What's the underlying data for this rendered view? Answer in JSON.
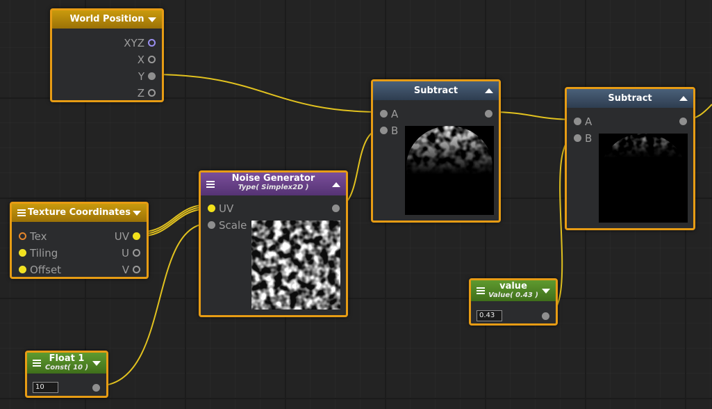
{
  "nodes": {
    "world_position": {
      "title": "World Position",
      "outputs": [
        "XYZ",
        "X",
        "Y",
        "Z"
      ]
    },
    "texture_coordinates": {
      "title": "Texture Coordinates",
      "inputs": [
        "Tex",
        "Tiling",
        "Offset"
      ],
      "outputs": [
        "UV",
        "U",
        "V"
      ]
    },
    "noise_generator": {
      "title": "Noise Generator",
      "subtitle": "Type( Simplex2D )",
      "inputs": [
        "UV",
        "Scale"
      ]
    },
    "subtract_1": {
      "title": "Subtract",
      "inputs": [
        "A",
        "B"
      ]
    },
    "subtract_2": {
      "title": "Subtract",
      "inputs": [
        "A",
        "B"
      ]
    },
    "value": {
      "title": "value",
      "subtitle": "Value( 0.43 )",
      "field": "0.43"
    },
    "float_1": {
      "title": "Float 1",
      "subtitle": "Const( 10 )",
      "field": "10"
    }
  },
  "colors": {
    "node_border": "#e79c14",
    "wire": "#e2c21f",
    "header_gold": "#b8880a",
    "header_blue": "#3c4e63",
    "header_purple": "#683f88",
    "header_green": "#528626"
  },
  "icons": [
    "chevron-down-icon",
    "chevron-up-icon",
    "hamburger-menu-icon"
  ]
}
